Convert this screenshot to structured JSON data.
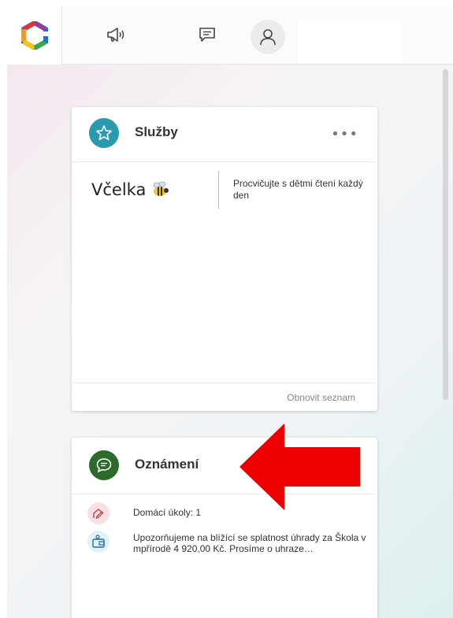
{
  "topbar": {
    "icons": [
      "announcement-icon",
      "message-icon",
      "user-icon"
    ]
  },
  "services_card": {
    "title": "Služby",
    "more_label": "•••",
    "service": {
      "name": "Včelka",
      "description": "Procvičujte s dětmi čtení každý den"
    },
    "footer_label": "Obnovit seznam"
  },
  "notices_card": {
    "title": "Oznámení",
    "items": [
      {
        "icon": "homework-icon",
        "text": "Domácí úkoly: 1"
      },
      {
        "icon": "wallet-icon",
        "text": "Upozorňujeme na blížící se splatnost úhrady za Škola v mpřírodě 4 920,00 Kč. Prosíme o uhraze…"
      }
    ]
  },
  "colors": {
    "services_accent": "#2a9ab0",
    "notices_accent": "#2d6b2d",
    "arrow": "#ee0000"
  }
}
